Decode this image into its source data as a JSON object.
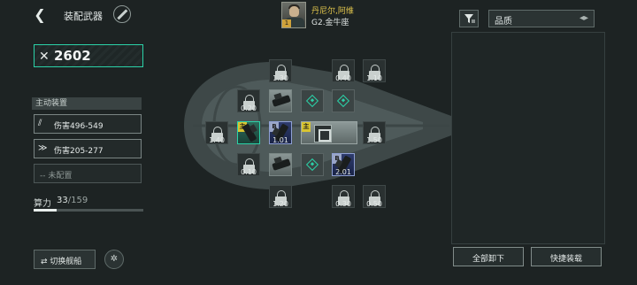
{
  "header": {
    "title": "装配武器",
    "pilot_name": "丹尼尔,阿维",
    "pilot_rank": "G2.金牛座",
    "pilot_level": "1"
  },
  "filter": {
    "quality_label": "品质",
    "sort_glyph": "◂▸"
  },
  "left": {
    "power_value": "2602",
    "section_title": "主动装置",
    "equip": [
      {
        "label": "伤害496-549",
        "icon": "missile-icon"
      },
      {
        "label": "伤害205-277",
        "icon": "beam-icon"
      },
      {
        "label": "-- 未配置",
        "icon": ""
      }
    ],
    "compute_label": "算力",
    "compute_used": "33",
    "compute_total": "/159",
    "compute_fraction": 0.21,
    "switch_label": "切换舰船"
  },
  "slots": {
    "v_130": "1.30",
    "v_040": "0.40",
    "v_110": "1.10",
    "v_020": "0.20",
    "v_140": "1.40",
    "v_101": "1.01",
    "v_150": "1.50",
    "v_010": "0.10",
    "v_201": "2.01",
    "v_120": "1.20",
    "v_030": "0.30",
    "v_050": "0.50",
    "main_tag": "主",
    "badge_b": "B"
  },
  "right": {
    "unload_all": "全部卸下",
    "quick_equip": "快捷装载"
  },
  "colors": {
    "accent": "#2bd2a8",
    "main_tag": "#d9c531",
    "pilot_name": "#e0c44c"
  }
}
